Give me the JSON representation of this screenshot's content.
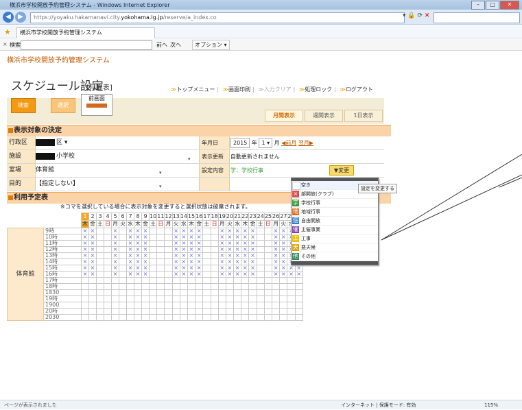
{
  "browser": {
    "window_title": "横浜市学校開放予約管理システム - Windows Internet Explorer",
    "url_prefix": "https://yoyaku.hakamanavi.city.",
    "url_domain": "yokohama.lg.jp",
    "url_suffix": "/reserve/a_index.co",
    "tab_label": "横浜市学校開放予約管理システム",
    "find_label": "検索:",
    "find_prev": "前へ",
    "find_next": "次へ",
    "find_options": "オプション ▾",
    "status_left": "ページが表示されました",
    "status_zone": "インターネット | 保護モード: 有効",
    "status_zoom": "115%"
  },
  "app": {
    "title": "横浜市学校開放予約管理システム",
    "page_title": "スケジュール設定",
    "page_subtitle": "[月間表]",
    "nav_links": [
      "トップメニュー",
      "画面印刷",
      "入力クリア",
      "処理ロック",
      "ログアウト"
    ],
    "buttons": {
      "search": "検索",
      "select": "選択",
      "prev_screen": "前画面"
    },
    "view_tabs": [
      "月間表示",
      "週間表示",
      "1日表示"
    ],
    "colors": {
      "accent": "#f39a12",
      "section": "#fbd3a8",
      "label_bg": "#fbe8c8",
      "sunday": "#e02020"
    }
  },
  "target": {
    "header": "表示対象の決定",
    "ward_label": "行政区",
    "ward_value": "区",
    "facility_label": "施設",
    "facility_value": "小学校",
    "room_label": "室場",
    "room_value": "体育館",
    "purpose_label": "目的",
    "purpose_value": "【指定しない】",
    "date_label": "年月日",
    "year": "2015",
    "year_unit": "年",
    "month": "1",
    "month_unit": "月",
    "prev_month": "前月",
    "next_month": "翌月",
    "update_label": "表示更新",
    "update_value": "自動更新されません",
    "setting_label": "設定内容",
    "setting_value": "学：学校行事",
    "change_button": "▼変更"
  },
  "schedule": {
    "header": "利用予定表",
    "notice": "※コマを選択している場合に表示対象を変更すると選択状態は破棄されます。",
    "facility": "体育館",
    "days": [
      "1",
      "2",
      "3",
      "4",
      "5",
      "6",
      "7",
      "8",
      "9",
      "10",
      "11",
      "12",
      "13",
      "14",
      "15",
      "16",
      "17",
      "18",
      "19",
      "20",
      "21",
      "22",
      "23",
      "24",
      "25",
      "26",
      "27",
      "28",
      "29",
      "30",
      "31"
    ],
    "weekdays": [
      "木",
      "金",
      "土",
      "日",
      "月",
      "火",
      "水",
      "木",
      "金",
      "土",
      "日",
      "月",
      "火",
      "水",
      "木",
      "金",
      "土",
      "日",
      "月",
      "火",
      "水",
      "木",
      "金",
      "土",
      "日",
      "月",
      "火",
      "水",
      "木",
      "金",
      "土"
    ],
    "hours": [
      "9時",
      "10時",
      "11時",
      "12時",
      "13時",
      "14時",
      "15時",
      "16時",
      "17時",
      "18時",
      "1830",
      "19時",
      "1900",
      "20時",
      "2030"
    ],
    "mark": "×"
  },
  "dropdown": {
    "tooltip": "設定を変更する",
    "items": [
      {
        "label": "空き",
        "icon": "",
        "color": "#ffffff"
      },
      {
        "label": "部開放(クラブ)",
        "icon": "×",
        "color": "#e05050"
      },
      {
        "label": "学校行事",
        "icon": "学",
        "color": "#3a9a3a"
      },
      {
        "label": "地域行事",
        "icon": "地",
        "color": "#e07020"
      },
      {
        "label": "自由開放",
        "icon": "個",
        "color": "#2a7fd0"
      },
      {
        "label": "主催事業",
        "icon": "催",
        "color": "#8040b0"
      },
      {
        "label": "工事",
        "icon": "工",
        "color": "#f0c000"
      },
      {
        "label": "悪天候",
        "icon": "天",
        "color": "#e8a000"
      },
      {
        "label": "その他",
        "icon": "他",
        "color": "#2e8b57"
      }
    ]
  }
}
